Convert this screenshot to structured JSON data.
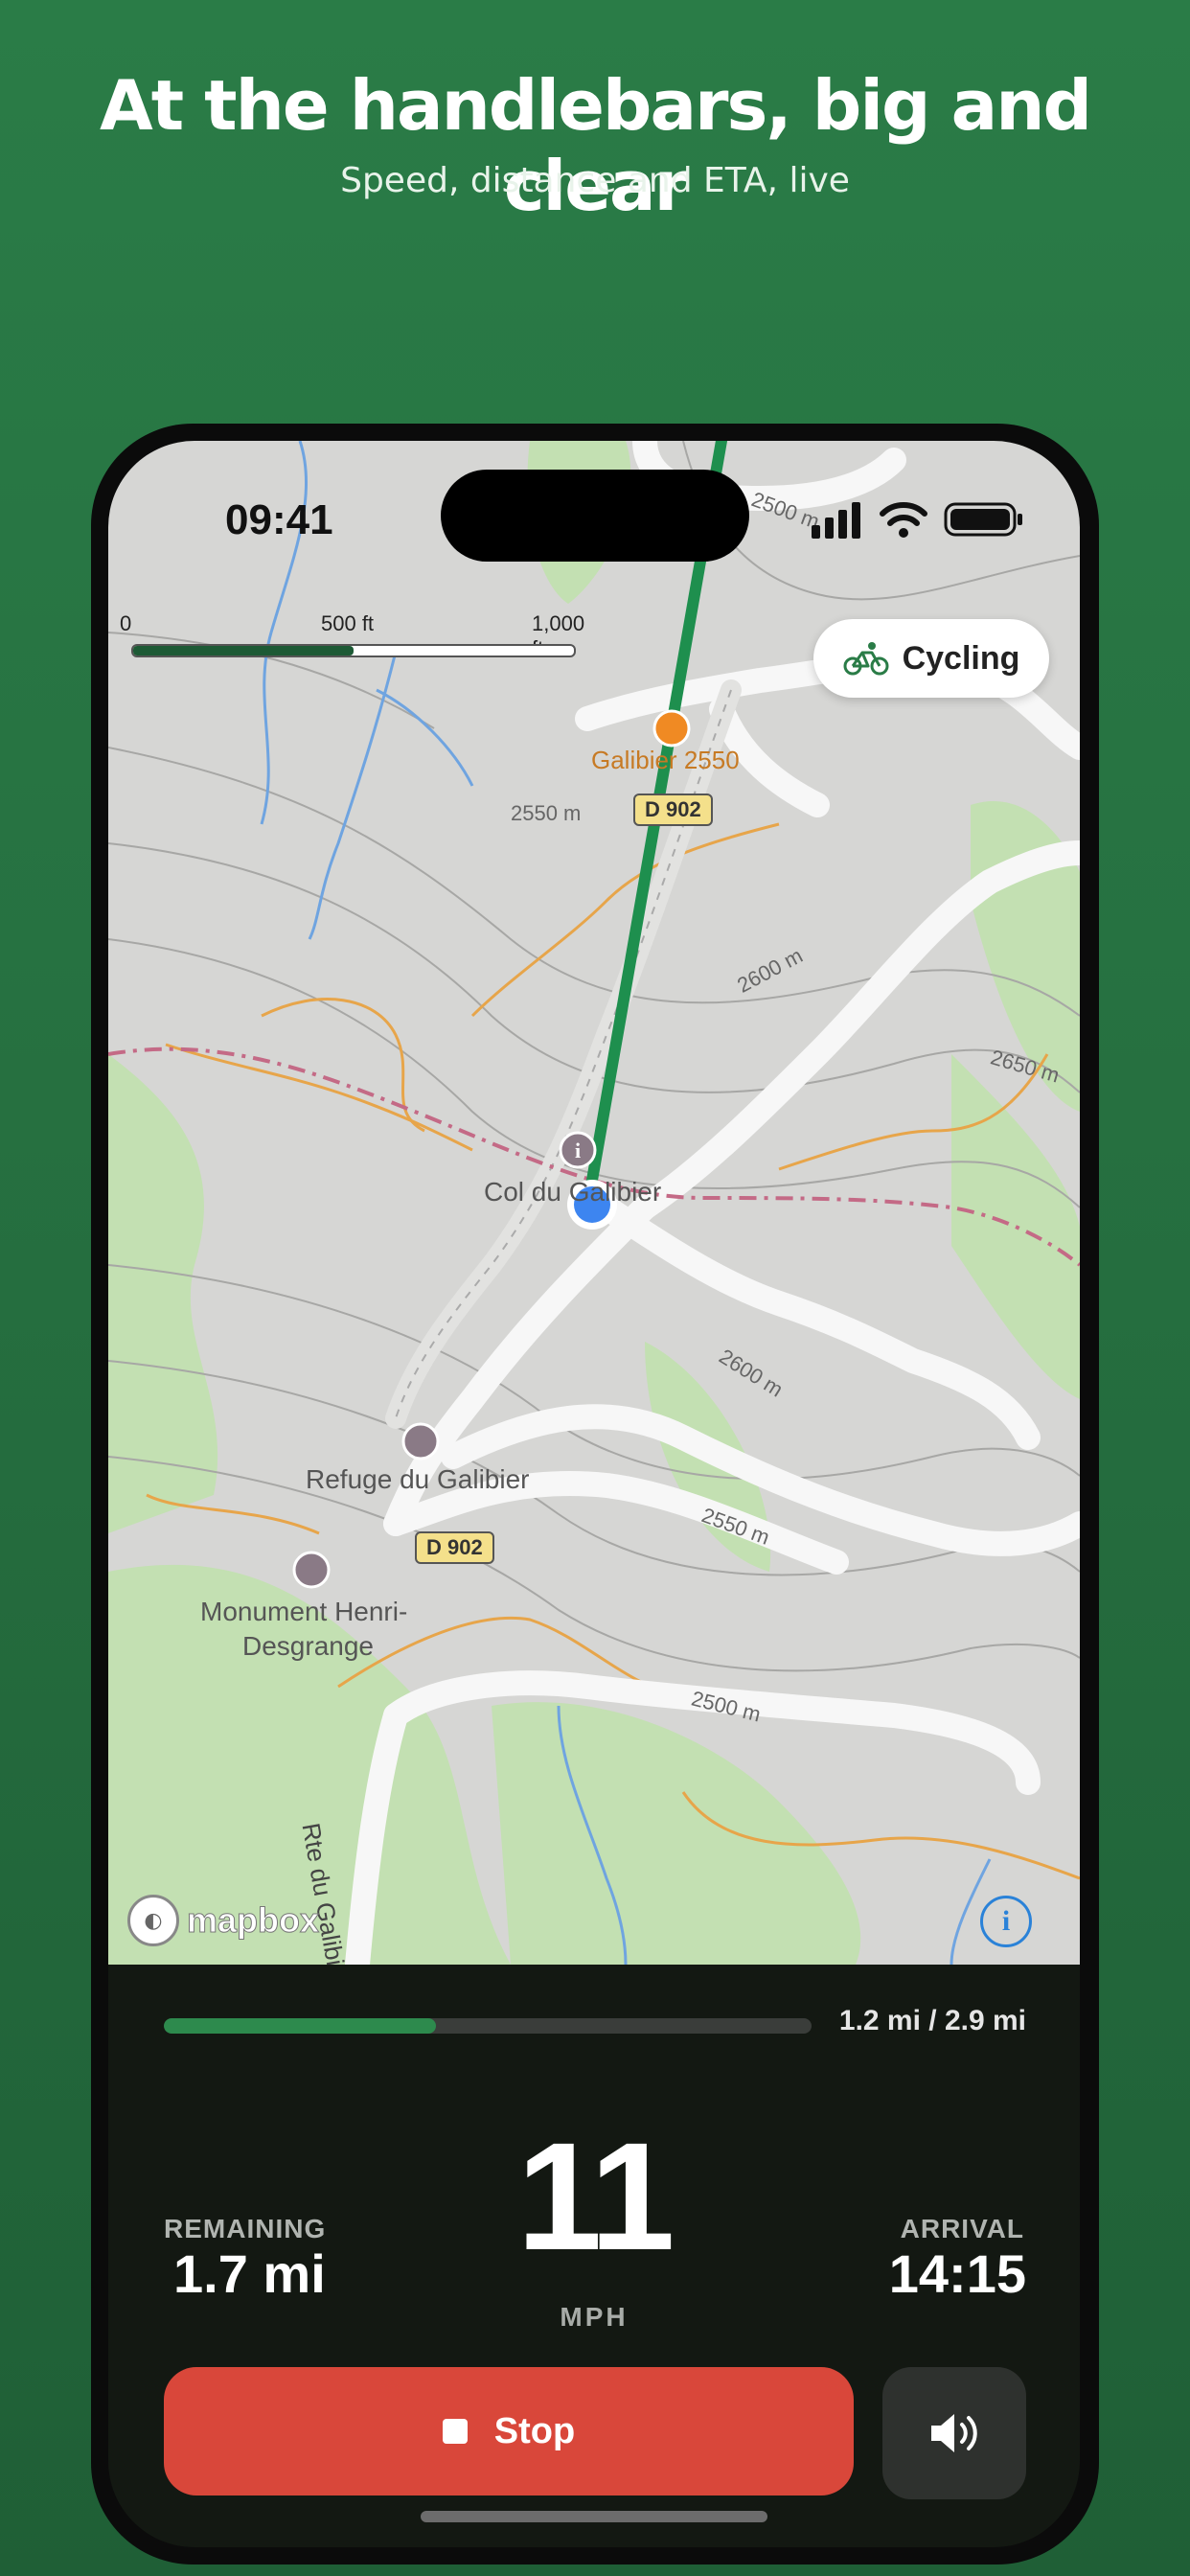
{
  "header": {
    "headline": "At the handlebars, big and clear",
    "subheadline": "Speed, distance and ETA, live"
  },
  "status_bar": {
    "time": "09:41",
    "icons": [
      "signal-icon",
      "wifi-icon",
      "battery-icon"
    ]
  },
  "map": {
    "mode_chip": {
      "label": "Cycling",
      "icon": "bicycle-icon"
    },
    "scale": {
      "labels": [
        "0",
        "500 ft",
        "1,000 ft"
      ]
    },
    "attribution": "mapbox",
    "places": [
      {
        "label": "Galibier 2550"
      },
      {
        "label": "Col du Galibier"
      },
      {
        "label": "Refuge du Galibier"
      },
      {
        "label": "Monument Henri-"
      },
      {
        "label": "Desgrange"
      },
      {
        "label": "Rte du Galibier"
      }
    ],
    "road_labels": [
      "D 902",
      "D 902"
    ],
    "contours": [
      "2500 m",
      "2550 m",
      "2600 m",
      "2650 m",
      "2600 m",
      "2550 m",
      "2500 m"
    ],
    "colors": {
      "route": "#1e8f4e",
      "location": "#3d85f0",
      "park": "#bfe0ad"
    }
  },
  "ride": {
    "progress_text": "1.2 mi / 2.9 mi",
    "progress_fraction": 0.42,
    "remaining_label": "REMAINING",
    "remaining_value": "1.7 mi",
    "speed": "11",
    "speed_unit": "MPH",
    "arrival_label": "ARRIVAL",
    "arrival_value": "14:15",
    "stop_label": "Stop",
    "colors": {
      "stop": "#d9473a",
      "progress": "#2d8a4d"
    }
  }
}
